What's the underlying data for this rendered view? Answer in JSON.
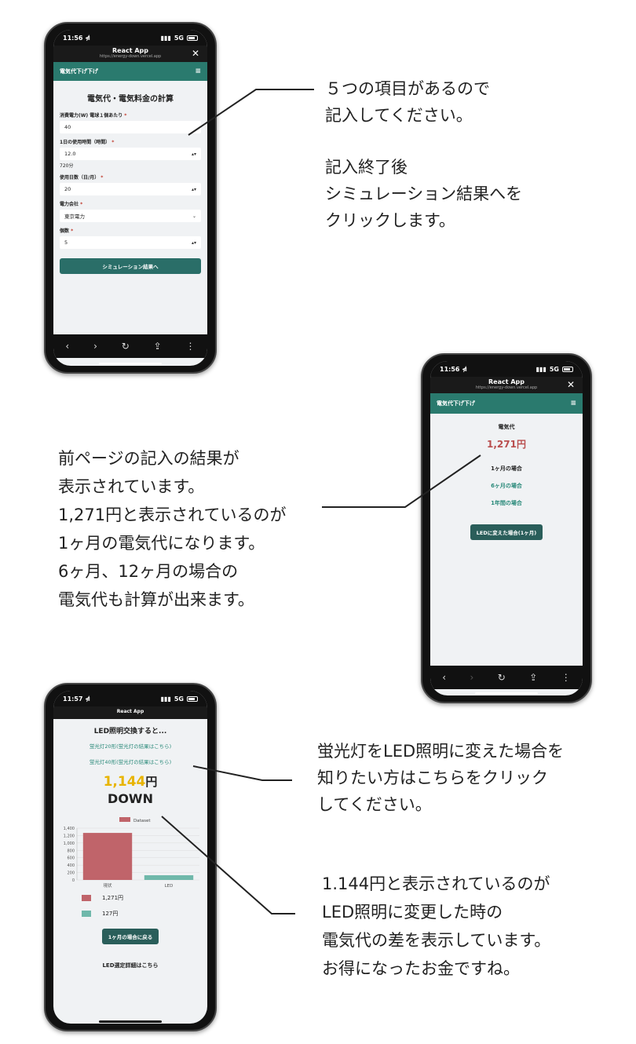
{
  "phone1": {
    "time": "11:56 ⋪",
    "signal": "5G",
    "browser_title": "React App",
    "browser_url": "https://energy-down.vercel.app",
    "app_name": "電気代下げ下げ",
    "heading": "電気代・電気料金の計算",
    "fields": [
      {
        "label": "消費電力(W) 電球１個あたり",
        "value": "40"
      },
      {
        "label": "1日の使用時間（時間）",
        "value": "12.0",
        "hint": "720分"
      },
      {
        "label": "使用日数（日/月）",
        "value": "20"
      },
      {
        "label": "電力会社",
        "value": "東京電力"
      },
      {
        "label": "個数",
        "value": "5"
      }
    ],
    "required_mark": "*",
    "submit": "シミュレーション結果へ"
  },
  "phone2": {
    "time": "11:56 ⋪",
    "signal": "5G",
    "browser_title": "React App",
    "browser_url": "https://energy-down.vercel.app",
    "app_name": "電気代下げ下げ",
    "label": "電気代",
    "cost": "1,271円",
    "periods": [
      "1ヶ月の場合",
      "6ヶ月の場合",
      "1年間の場合"
    ],
    "led_button": "LEDに変えた場合(1ヶ月)"
  },
  "phone3": {
    "time": "11:57 ⋪",
    "signal": "5G",
    "browser_title": "React App",
    "heading": "LED照明交換すると...",
    "link1": "蛍光灯20形(蛍光灯の結果はこちら)",
    "link2": "蛍光灯40形(蛍光灯の結果はこちら)",
    "diff_value": "1,144",
    "diff_unit": "円",
    "down": "DOWN",
    "legend_dataset": "Dataset",
    "legend_current": "1,271円",
    "legend_led": "127円",
    "back_button": "1ヶ月の場合に戻る",
    "detail": "LED選定詳細はこちら",
    "chart_colors": {
      "current": "#c0646a",
      "led": "#6fb8aa"
    }
  },
  "chart_data": {
    "type": "bar",
    "categories": [
      "現状",
      "LED"
    ],
    "series": [
      {
        "name": "Dataset",
        "values": [
          1271,
          127
        ]
      }
    ],
    "yticks": [
      0,
      200,
      400,
      600,
      800,
      "1,000",
      "1,200",
      "1,400"
    ],
    "ylim": [
      0,
      1400
    ],
    "legend": "top"
  },
  "notes": {
    "note1": [
      "５つの項目があるので",
      "記入してください。"
    ],
    "note2": [
      "記入終了後",
      "シミュレーション結果へを",
      "クリックします。"
    ],
    "note3": [
      "前ページの記入の結果が",
      "表示されています。",
      "1,271円と表示されているのが",
      "1ヶ月の電気代になります。",
      "6ヶ月、12ヶ月の場合の",
      "電気代も計算が出来ます。"
    ],
    "note4": [
      "蛍光灯をLED照明に変えた場合を",
      "知りたい方はこちらをクリック",
      "してください。"
    ],
    "note5": [
      "1.144円と表示されているのが",
      "LED照明に変更した時の",
      "電気代の差を表示しています。",
      "お得になったお金ですね。"
    ]
  }
}
